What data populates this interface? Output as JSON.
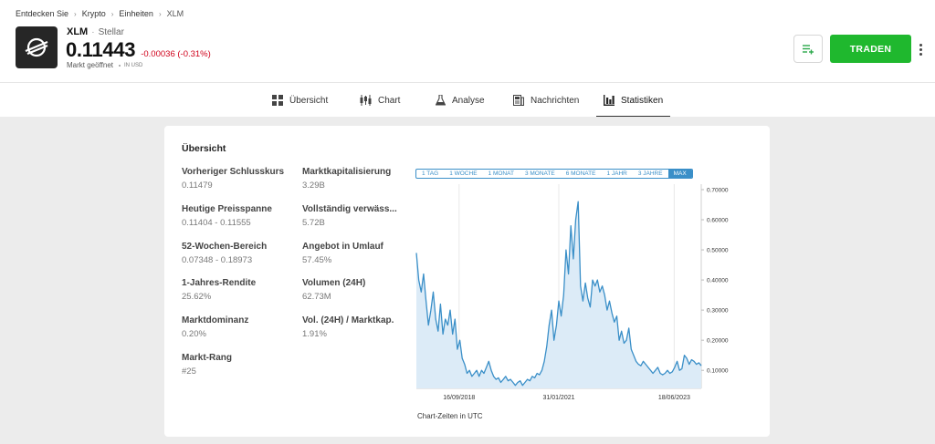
{
  "breadcrumb": [
    "Entdecken Sie",
    "Krypto",
    "Einheiten",
    "XLM"
  ],
  "instrument": {
    "symbol": "XLM",
    "name": "Stellar",
    "price": "0.11443",
    "change": "-0.00036 (-0.31%)",
    "market_status": "Markt geöffnet",
    "currency": "IN USD",
    "logo_icon": "stellar-logo-icon"
  },
  "actions": {
    "watchlist_icon": "add-to-list-icon",
    "trade_label": "TRADEN",
    "more_icon": "more-vertical-icon"
  },
  "tabs": [
    {
      "label": "Übersicht",
      "icon": "grid-icon",
      "active": false
    },
    {
      "label": "Chart",
      "icon": "candlestick-icon",
      "active": false
    },
    {
      "label": "Analyse",
      "icon": "flask-icon",
      "active": false
    },
    {
      "label": "Nachrichten",
      "icon": "news-icon",
      "active": false
    },
    {
      "label": "Statistiken",
      "icon": "bar-chart-icon",
      "active": true
    }
  ],
  "overview": {
    "title": "Übersicht",
    "left": [
      {
        "label": "Vorheriger Schlusskurs",
        "value": "0.11479"
      },
      {
        "label": "Heutige Preisspanne",
        "value": "0.11404 - 0.11555"
      },
      {
        "label": "52-Wochen-Bereich",
        "value": "0.07348 - 0.18973"
      },
      {
        "label": "1-Jahres-Rendite",
        "value": "25.62%"
      },
      {
        "label": "Marktdominanz",
        "value": "0.20%"
      },
      {
        "label": "Markt-Rang",
        "value": "#25"
      }
    ],
    "right": [
      {
        "label": "Marktkapitalisierung",
        "value": "3.29B"
      },
      {
        "label": "Vollständig verwäss...",
        "value": "5.72B"
      },
      {
        "label": "Angebot in Umlauf",
        "value": "57.45%"
      },
      {
        "label": "Volumen (24H)",
        "value": "62.73M"
      },
      {
        "label": "Vol. (24H) / Marktkap.",
        "value": "1.91%"
      }
    ]
  },
  "ranges": [
    "1 TAG",
    "1 WOCHE",
    "1 MONAT",
    "3 MONATE",
    "6 MONATE",
    "1 JAHR",
    "3 JAHRE",
    "MAX"
  ],
  "active_range": "MAX",
  "chart_note": "Chart-Zeiten in UTC",
  "colors": {
    "accent": "#3a8fc8",
    "trade": "#1fb82e",
    "negative": "#d0021b"
  },
  "chart_data": {
    "type": "area",
    "title": "",
    "xlabel": "",
    "ylabel": "",
    "x_ticks": [
      "16/09/2018",
      "31/01/2021",
      "18/06/2023"
    ],
    "y_ticks": [
      "0.10000",
      "0.20000",
      "0.30000",
      "0.40000",
      "0.50000",
      "0.60000",
      "0.70000"
    ],
    "ylim": [
      0.04,
      0.7
    ],
    "grid": "vertical",
    "series": [
      {
        "values": [
          0.49,
          0.4,
          0.36,
          0.42,
          0.33,
          0.25,
          0.3,
          0.36,
          0.27,
          0.23,
          0.32,
          0.22,
          0.27,
          0.25,
          0.3,
          0.22,
          0.27,
          0.17,
          0.2,
          0.14,
          0.12,
          0.09,
          0.1,
          0.08,
          0.09,
          0.1,
          0.08,
          0.1,
          0.09,
          0.11,
          0.13,
          0.1,
          0.08,
          0.07,
          0.075,
          0.06,
          0.07,
          0.08,
          0.065,
          0.07,
          0.06,
          0.05,
          0.06,
          0.065,
          0.05,
          0.06,
          0.07,
          0.065,
          0.08,
          0.075,
          0.09,
          0.085,
          0.1,
          0.13,
          0.18,
          0.25,
          0.3,
          0.2,
          0.25,
          0.33,
          0.28,
          0.35,
          0.5,
          0.42,
          0.58,
          0.47,
          0.6,
          0.66,
          0.38,
          0.33,
          0.39,
          0.34,
          0.31,
          0.4,
          0.38,
          0.4,
          0.36,
          0.38,
          0.35,
          0.3,
          0.33,
          0.29,
          0.26,
          0.28,
          0.2,
          0.23,
          0.19,
          0.2,
          0.24,
          0.17,
          0.15,
          0.13,
          0.12,
          0.115,
          0.13,
          0.12,
          0.11,
          0.1,
          0.09,
          0.1,
          0.11,
          0.09,
          0.085,
          0.09,
          0.1,
          0.09,
          0.095,
          0.11,
          0.13,
          0.1,
          0.105,
          0.15,
          0.14,
          0.12,
          0.135,
          0.13,
          0.12,
          0.125,
          0.115
        ]
      }
    ]
  }
}
